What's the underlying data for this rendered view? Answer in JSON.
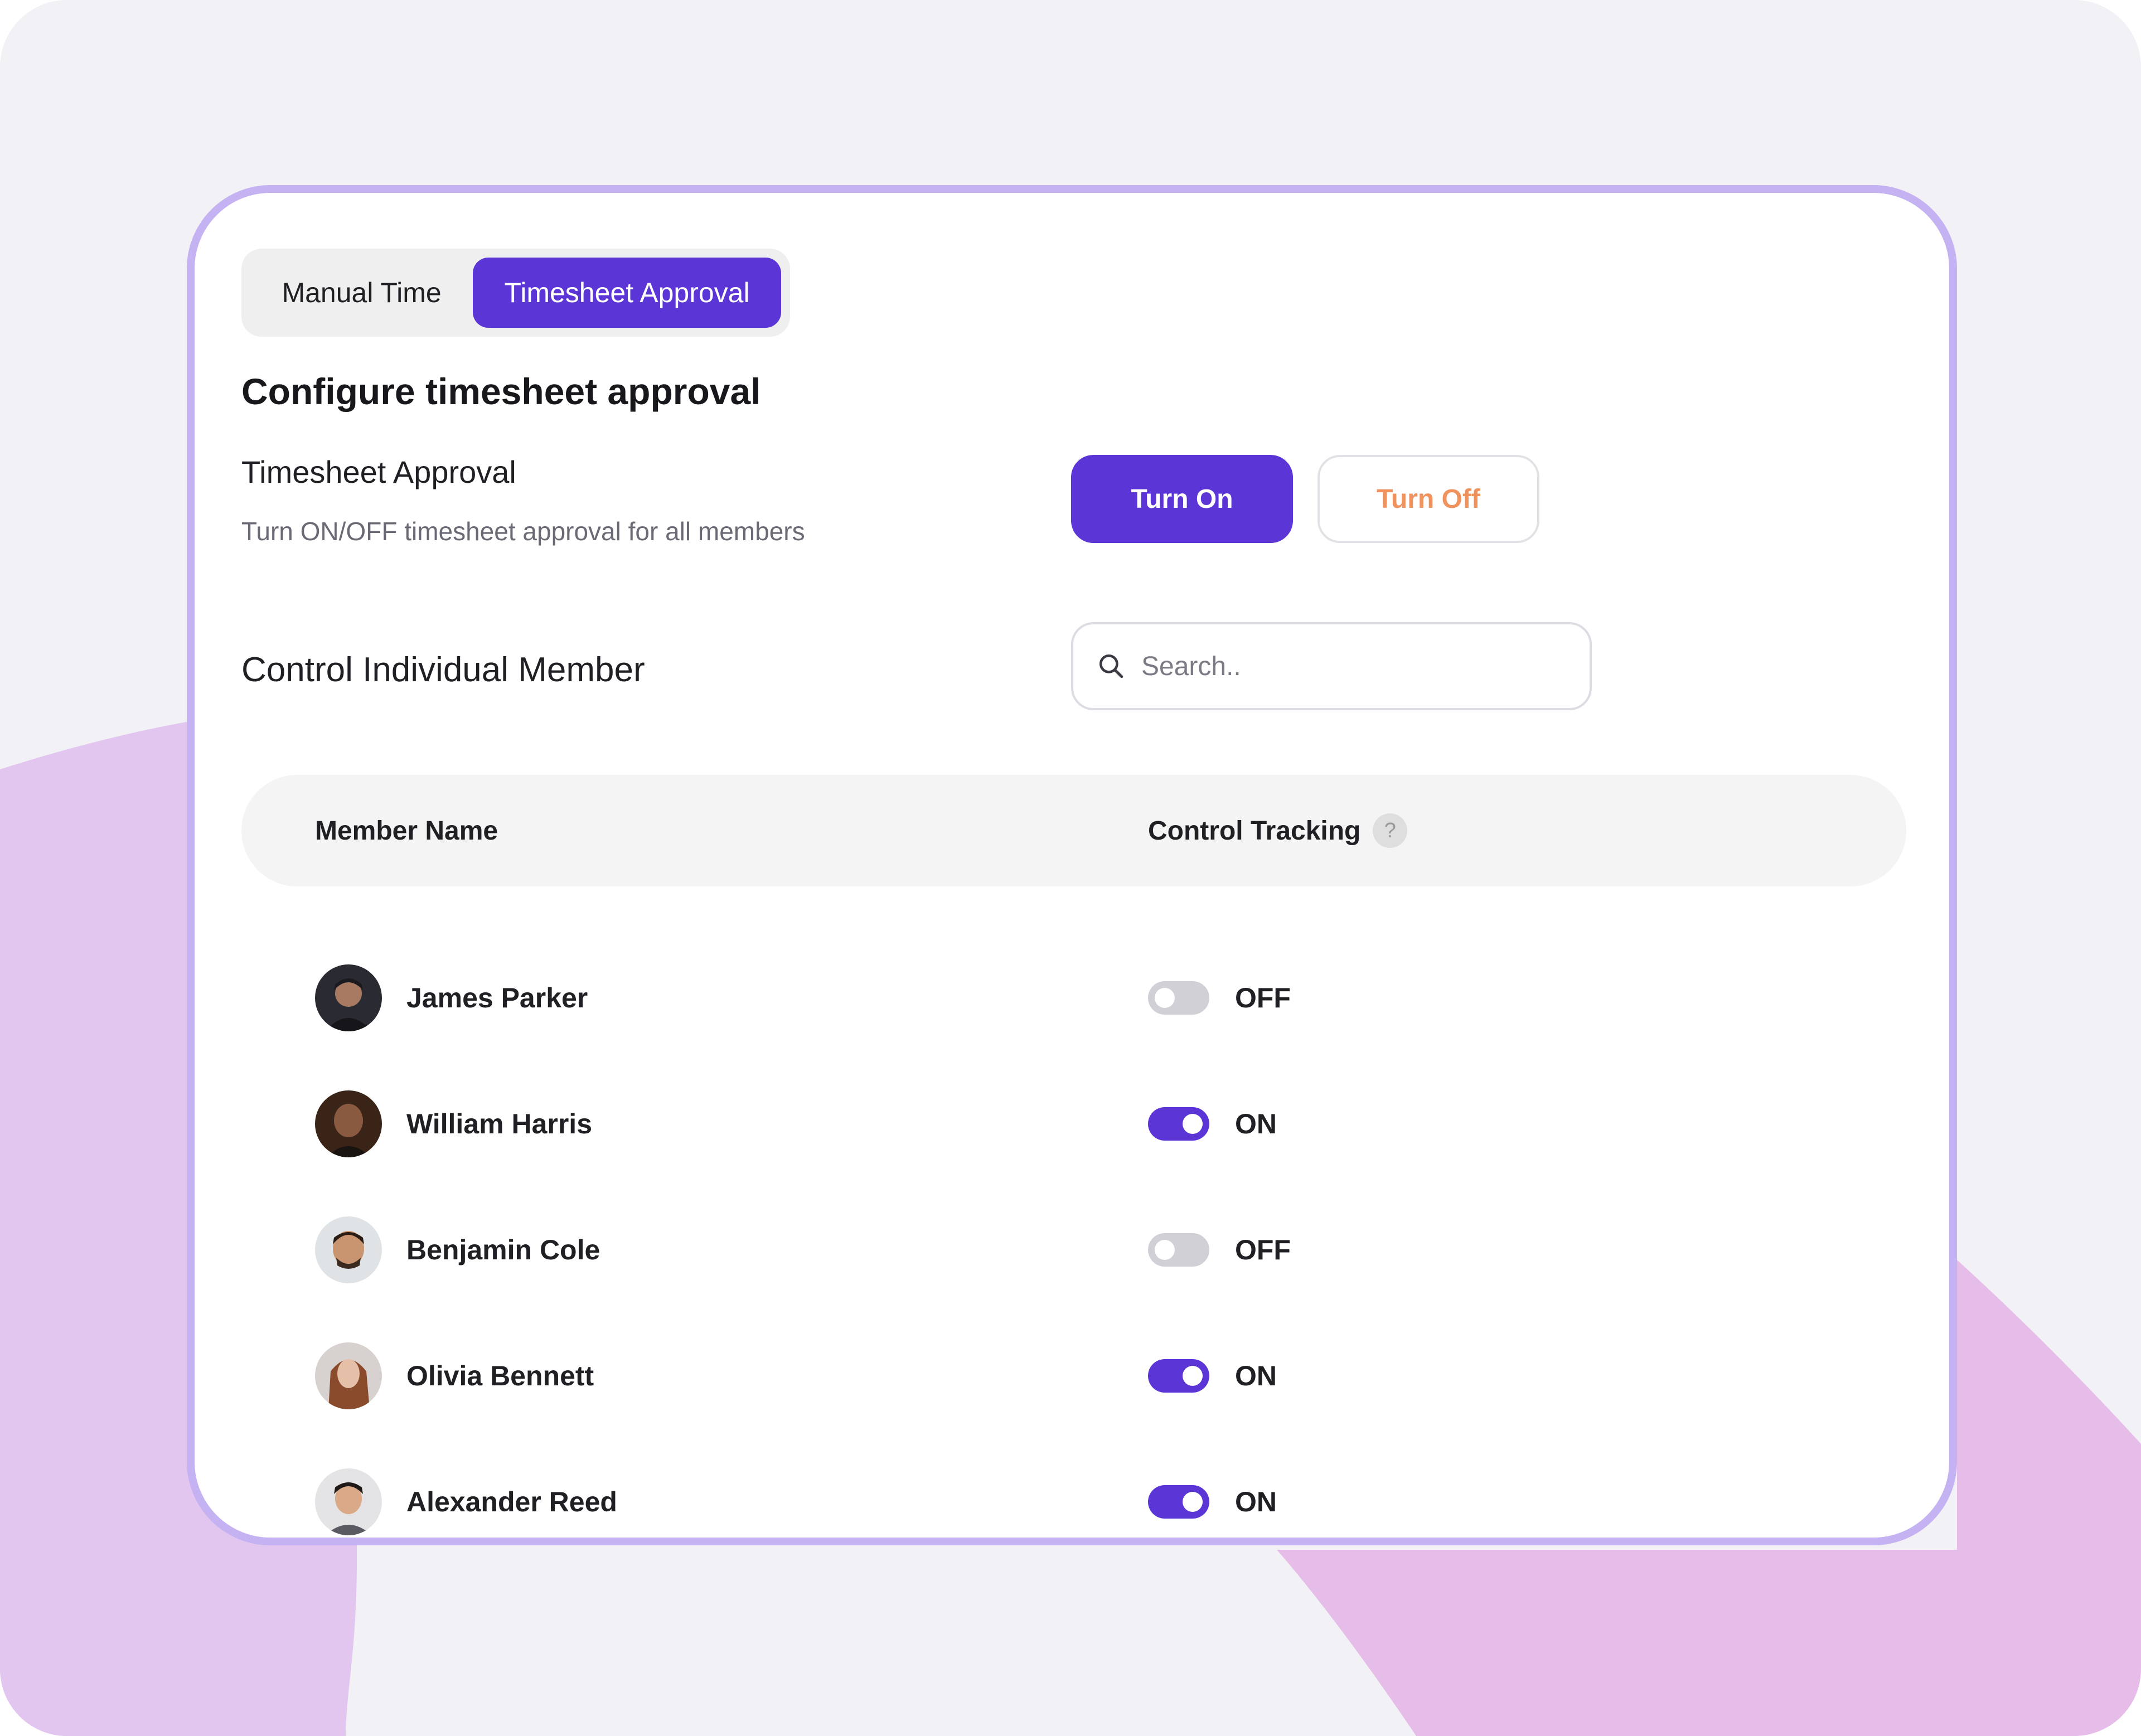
{
  "colors": {
    "accent": "#5b35d5",
    "turn_off_text": "#f0925d",
    "card_border": "#c4b2f2",
    "background_blob": "#e2c6f0",
    "toggle_off": "#d0d0d6"
  },
  "tabs": [
    {
      "label": "Manual Time",
      "active": false
    },
    {
      "label": "Timesheet Approval",
      "active": true
    }
  ],
  "heading": "Configure timesheet approval",
  "approval": {
    "title": "Timesheet Approval",
    "description": "Turn ON/OFF timesheet approval for all members",
    "turn_on_label": "Turn On",
    "turn_off_label": "Turn Off"
  },
  "control": {
    "title": "Control Individual Member",
    "search_placeholder": "Search.."
  },
  "table": {
    "col_member": "Member Name",
    "col_control": "Control Tracking",
    "help_glyph": "?"
  },
  "members": [
    {
      "name": "James Parker",
      "tracking": "OFF",
      "on": false
    },
    {
      "name": "William Harris",
      "tracking": "ON",
      "on": true
    },
    {
      "name": "Benjamin Cole",
      "tracking": "OFF",
      "on": false
    },
    {
      "name": "Olivia Bennett",
      "tracking": "ON",
      "on": true
    },
    {
      "name": "Alexander Reed",
      "tracking": "ON",
      "on": true
    }
  ]
}
